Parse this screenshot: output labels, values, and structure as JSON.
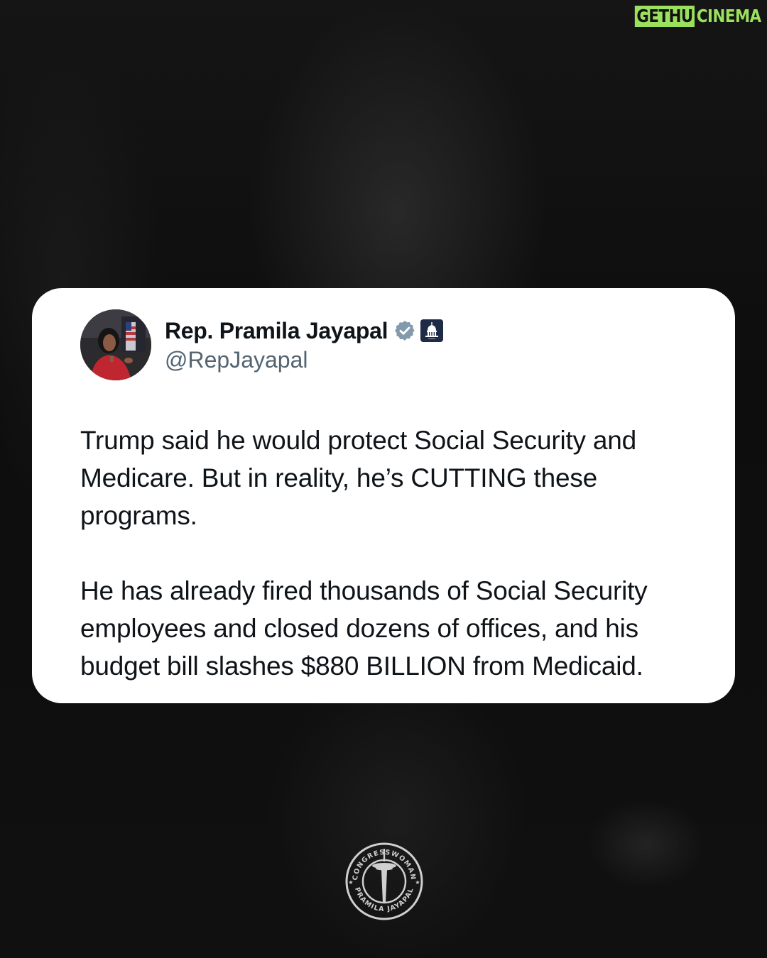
{
  "watermark": {
    "part1": "GETHU",
    "part2": "CINEMA"
  },
  "tweet": {
    "author_name": "Rep. Pramila Jayapal",
    "handle": "@RepJayapal",
    "verified_icon": "verified-badge-icon",
    "affiliation_icon": "us-capitol-government-badge-icon",
    "paragraphs": [
      "Trump said he would protect Social Security and Medicare. But in reality, he’s CUTTING these programs.",
      "He has already fired thousands of Social Security employees and closed dozens of offices, and his budget bill slashes $880 BILLION from Medicaid."
    ]
  },
  "seal": {
    "top_text": "CONGRESSWOMAN",
    "bottom_text": "PRAMILA JAYAPAL",
    "icon": "space-needle-icon"
  },
  "colors": {
    "background": "#0b0b0b",
    "card": "#ffffff",
    "name_text": "#0f1419",
    "handle_text": "#536471",
    "verified": "#829aab",
    "watermark_green": "#9be15d"
  }
}
